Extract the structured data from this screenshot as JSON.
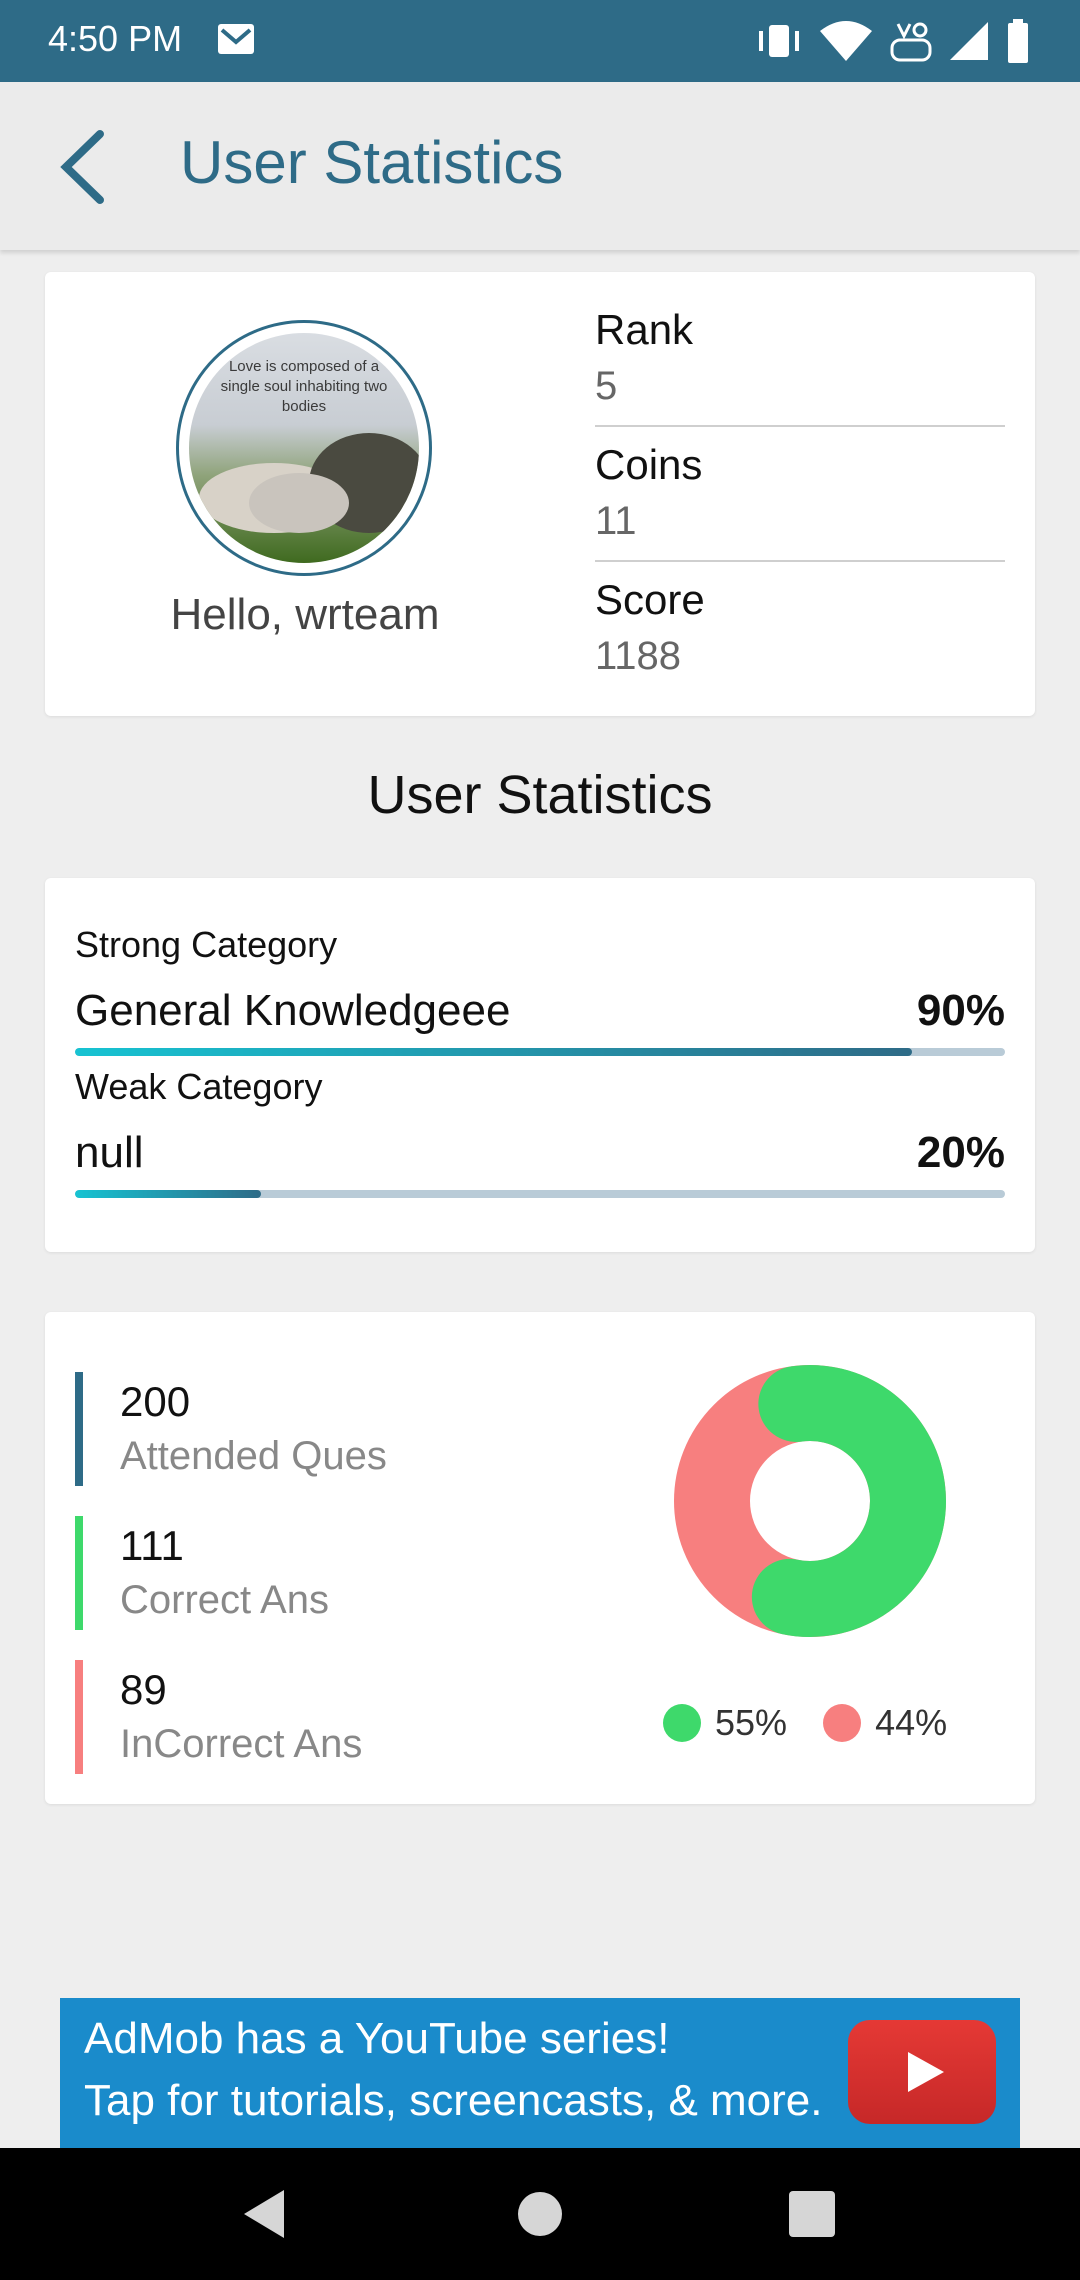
{
  "status_bar": {
    "time": "4:50 PM",
    "icons": [
      "mail-icon",
      "vibrate-icon",
      "wifi-icon",
      "volte-icon",
      "signal-icon",
      "battery-icon"
    ]
  },
  "app_bar": {
    "title": "User Statistics",
    "back_icon": "back-arrow-icon"
  },
  "profile": {
    "avatar_caption": "Love is composed of a single soul inhabiting two bodies",
    "greeting": "Hello, wrteam",
    "stats": [
      {
        "label": "Rank",
        "value": "5"
      },
      {
        "label": "Coins",
        "value": "11"
      },
      {
        "label": "Score",
        "value": "1188"
      }
    ]
  },
  "section_title": "User Statistics",
  "categories": {
    "strong": {
      "caption": "Strong Category",
      "name": "General Knowledgeee",
      "percent": "90%",
      "progress": 0.9
    },
    "weak": {
      "caption": "Weak Category",
      "name": "null",
      "percent": "20%",
      "progress": 0.2
    }
  },
  "summary": {
    "items": [
      {
        "value": "200",
        "label": "Attended Ques",
        "color": "#2e6b87"
      },
      {
        "value": "111",
        "label": "Correct Ans",
        "color": "#3ed96b"
      },
      {
        "value": "89",
        "label": "InCorrect Ans",
        "color": "#f77f7f"
      }
    ],
    "donut": {
      "correct_fraction": 0.555,
      "correct_color": "#3ed96b",
      "incorrect_color": "#f77f7f"
    },
    "legend": [
      {
        "label": "55%",
        "color": "#3ed96b"
      },
      {
        "label": "44%",
        "color": "#f77f7f"
      }
    ]
  },
  "ad": {
    "line1": "AdMob has a YouTube series!",
    "line2": "Tap for tutorials, screencasts, & more.",
    "icon": "youtube-play-icon"
  },
  "nav_bar": {
    "buttons": [
      "nav-back-icon",
      "nav-home-icon",
      "nav-recents-icon"
    ]
  }
}
